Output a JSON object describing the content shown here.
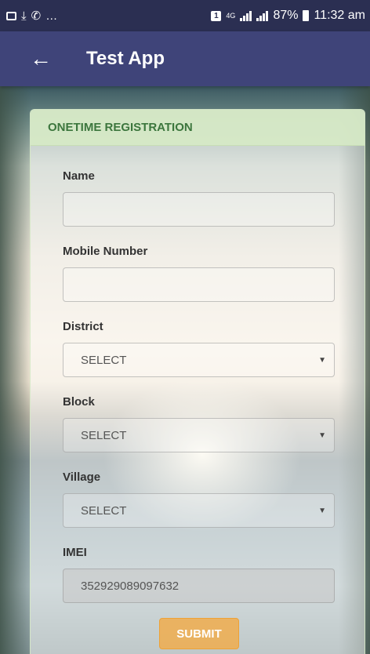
{
  "status_bar": {
    "left_icons": [
      "image-icon",
      "download-icon",
      "whatsapp-icon",
      "more-notifications-icon"
    ],
    "sim_badge": "1",
    "network": "4G",
    "battery": "87%",
    "time": "11:32 am"
  },
  "app_bar": {
    "back_icon": "back-arrow-icon",
    "title": "Test App"
  },
  "form": {
    "header": "ONETIME REGISTRATION",
    "name": {
      "label": "Name",
      "value": ""
    },
    "mobile": {
      "label": "Mobile Number",
      "value": ""
    },
    "district": {
      "label": "District",
      "selected": "SELECT"
    },
    "block": {
      "label": "Block",
      "selected": "SELECT"
    },
    "village": {
      "label": "Village",
      "selected": "SELECT"
    },
    "imei": {
      "label": "IMEI",
      "value": "352929089097632"
    },
    "submit_label": "SUBMIT"
  },
  "colors": {
    "status_bar": "#2b2f52",
    "app_bar": "#3f4479",
    "header_text": "#3c763d",
    "submit": "#f0ad4e"
  }
}
